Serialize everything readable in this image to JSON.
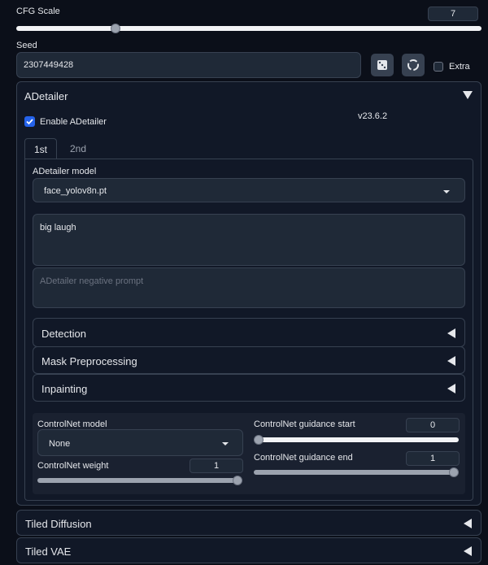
{
  "cfg": {
    "label": "CFG Scale",
    "value": "7",
    "fraction": 0.236
  },
  "seed": {
    "label": "Seed",
    "value": "2307449428",
    "dice_icon": "dice-icon",
    "recycle_icon": "recycle-icon",
    "extra_label": "Extra"
  },
  "adetailer": {
    "title": "ADetailer",
    "enable_label": "Enable ADetailer",
    "version": "v23.6.2",
    "tabs": [
      {
        "label": "1st"
      },
      {
        "label": "2nd"
      }
    ],
    "model_label": "ADetailer model",
    "model_value": "face_yolov8n.pt",
    "prompt_value": "big laugh",
    "negative_placeholder": "ADetailer negative prompt",
    "sections": [
      {
        "label": "Detection"
      },
      {
        "label": "Mask Preprocessing"
      },
      {
        "label": "Inpainting"
      }
    ],
    "controlnet": {
      "model_label": "ControlNet model",
      "model_value": "None",
      "weight_label": "ControlNet weight",
      "weight_value": "1",
      "weight_fraction": 1.0,
      "start_label": "ControlNet guidance start",
      "start_value": "0",
      "start_fraction": 0.0,
      "end_label": "ControlNet guidance end",
      "end_value": "1",
      "end_fraction": 1.0
    }
  },
  "bottom": [
    {
      "label": "Tiled Diffusion"
    },
    {
      "label": "Tiled VAE"
    }
  ],
  "colors": {
    "accent": "#2563eb",
    "slider_active": "#f3f4f6",
    "slider_inactive": "#6b7280"
  }
}
